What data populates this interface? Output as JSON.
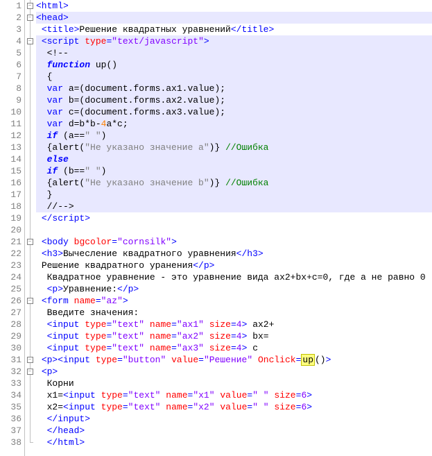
{
  "lines": [
    {
      "n": 1,
      "hl": false,
      "fold": "box",
      "parts": [
        {
          "c": "tag",
          "t": "<html>"
        }
      ]
    },
    {
      "n": 2,
      "hl": true,
      "fold": "box",
      "parts": [
        {
          "c": "tag",
          "t": "<head>"
        }
      ]
    },
    {
      "n": 3,
      "hl": false,
      "fold": "line",
      "parts": [
        {
          "c": "",
          "t": " "
        },
        {
          "c": "tag",
          "t": "<title>"
        },
        {
          "c": "txt",
          "t": "Решение квадратных уравнений"
        },
        {
          "c": "tag",
          "t": "</title>"
        }
      ]
    },
    {
      "n": 4,
      "hl": true,
      "fold": "box",
      "parts": [
        {
          "c": "",
          "t": " "
        },
        {
          "c": "tag",
          "t": "<script"
        },
        {
          "c": "",
          "t": " "
        },
        {
          "c": "attr",
          "t": "type"
        },
        {
          "c": "tag",
          "t": "="
        },
        {
          "c": "str",
          "t": "\"text/javascript\""
        },
        {
          "c": "tag",
          "t": ">"
        }
      ]
    },
    {
      "n": 5,
      "hl": true,
      "fold": "line",
      "parts": [
        {
          "c": "",
          "t": "  "
        },
        {
          "c": "txt",
          "t": "<!--"
        }
      ]
    },
    {
      "n": 6,
      "hl": true,
      "fold": "line",
      "parts": [
        {
          "c": "",
          "t": "  "
        },
        {
          "c": "kw",
          "t": "function"
        },
        {
          "c": "",
          "t": " "
        },
        {
          "c": "txt",
          "t": "up()"
        }
      ]
    },
    {
      "n": 7,
      "hl": true,
      "fold": "line",
      "parts": [
        {
          "c": "",
          "t": "  "
        },
        {
          "c": "txt",
          "t": "{"
        }
      ]
    },
    {
      "n": 8,
      "hl": true,
      "fold": "line",
      "parts": [
        {
          "c": "",
          "t": "  "
        },
        {
          "c": "kw2",
          "t": "var"
        },
        {
          "c": "",
          "t": " "
        },
        {
          "c": "txt",
          "t": "a=(document.forms.ax1.value);"
        }
      ]
    },
    {
      "n": 9,
      "hl": true,
      "fold": "line",
      "parts": [
        {
          "c": "",
          "t": "  "
        },
        {
          "c": "kw2",
          "t": "var"
        },
        {
          "c": "",
          "t": " "
        },
        {
          "c": "txt",
          "t": "b=(document.forms.ax2.value);"
        }
      ]
    },
    {
      "n": 10,
      "hl": true,
      "fold": "line",
      "parts": [
        {
          "c": "",
          "t": "  "
        },
        {
          "c": "kw2",
          "t": "var"
        },
        {
          "c": "",
          "t": " "
        },
        {
          "c": "txt",
          "t": "c=(document.forms.ax3.value);"
        }
      ]
    },
    {
      "n": 11,
      "hl": true,
      "fold": "line",
      "parts": [
        {
          "c": "",
          "t": "  "
        },
        {
          "c": "kw2",
          "t": "var"
        },
        {
          "c": "",
          "t": " "
        },
        {
          "c": "txt",
          "t": "d=b*b-"
        },
        {
          "c": "num",
          "t": "4"
        },
        {
          "c": "txt",
          "t": "a*c;"
        }
      ]
    },
    {
      "n": 12,
      "hl": true,
      "fold": "line",
      "parts": [
        {
          "c": "",
          "t": "  "
        },
        {
          "c": "kw",
          "t": "if"
        },
        {
          "c": "",
          "t": " "
        },
        {
          "c": "txt",
          "t": "(a=="
        },
        {
          "c": "gry",
          "t": "\" \""
        },
        {
          "c": "txt",
          "t": ")"
        }
      ]
    },
    {
      "n": 13,
      "hl": true,
      "fold": "line",
      "parts": [
        {
          "c": "",
          "t": "  "
        },
        {
          "c": "txt",
          "t": "{alert("
        },
        {
          "c": "gry",
          "t": "\"Не указано значение a\""
        },
        {
          "c": "txt",
          "t": ")} "
        },
        {
          "c": "cmt",
          "t": "//Ошибка"
        }
      ]
    },
    {
      "n": 14,
      "hl": true,
      "fold": "line",
      "parts": [
        {
          "c": "",
          "t": "  "
        },
        {
          "c": "kw",
          "t": "else"
        }
      ]
    },
    {
      "n": 15,
      "hl": true,
      "fold": "line",
      "parts": [
        {
          "c": "",
          "t": "  "
        },
        {
          "c": "kw",
          "t": "if"
        },
        {
          "c": "",
          "t": " "
        },
        {
          "c": "txt",
          "t": "(b=="
        },
        {
          "c": "gry",
          "t": "\" \""
        },
        {
          "c": "txt",
          "t": ")"
        }
      ]
    },
    {
      "n": 16,
      "hl": true,
      "fold": "line",
      "parts": [
        {
          "c": "",
          "t": "  "
        },
        {
          "c": "txt",
          "t": "{alert("
        },
        {
          "c": "gry",
          "t": "\"Не указано значение b\""
        },
        {
          "c": "txt",
          "t": ")} "
        },
        {
          "c": "cmt",
          "t": "//Ошибка"
        }
      ]
    },
    {
      "n": 17,
      "hl": true,
      "fold": "line",
      "parts": [
        {
          "c": "",
          "t": "  "
        },
        {
          "c": "txt",
          "t": "}"
        }
      ]
    },
    {
      "n": 18,
      "hl": true,
      "fold": "line",
      "parts": [
        {
          "c": "",
          "t": "  "
        },
        {
          "c": "txt",
          "t": "//-->"
        }
      ]
    },
    {
      "n": 19,
      "hl": false,
      "fold": "line",
      "parts": [
        {
          "c": "",
          "t": " "
        },
        {
          "c": "tag",
          "t": "</script>"
        }
      ]
    },
    {
      "n": 20,
      "hl": false,
      "fold": "line",
      "parts": []
    },
    {
      "n": 21,
      "hl": false,
      "fold": "box",
      "parts": [
        {
          "c": "",
          "t": " "
        },
        {
          "c": "tag",
          "t": "<body"
        },
        {
          "c": "",
          "t": " "
        },
        {
          "c": "attr",
          "t": "bgcolor"
        },
        {
          "c": "tag",
          "t": "="
        },
        {
          "c": "str",
          "t": "\"cornsilk\""
        },
        {
          "c": "tag",
          "t": ">"
        }
      ]
    },
    {
      "n": 22,
      "hl": false,
      "fold": "line",
      "parts": [
        {
          "c": "",
          "t": " "
        },
        {
          "c": "tag",
          "t": "<h3>"
        },
        {
          "c": "txt",
          "t": "Вычесление квадратного уравнения"
        },
        {
          "c": "tag",
          "t": "</h3>"
        }
      ]
    },
    {
      "n": 23,
      "hl": false,
      "fold": "line",
      "parts": [
        {
          "c": "",
          "t": " "
        },
        {
          "c": "txt",
          "t": "Решение квадратного уранения"
        },
        {
          "c": "tag",
          "t": "</p>"
        }
      ]
    },
    {
      "n": 24,
      "hl": false,
      "fold": "line",
      "parts": [
        {
          "c": "",
          "t": "  "
        },
        {
          "c": "txt",
          "t": "Квадратное уравнение - это уравнение вида ax2+bx+c=0, где a не равно 0"
        }
      ]
    },
    {
      "n": 25,
      "hl": false,
      "fold": "line",
      "parts": [
        {
          "c": "",
          "t": "  "
        },
        {
          "c": "tag",
          "t": "<p>"
        },
        {
          "c": "txt",
          "t": "Уравнение:"
        },
        {
          "c": "tag",
          "t": "</p>"
        }
      ]
    },
    {
      "n": 26,
      "hl": false,
      "fold": "box",
      "parts": [
        {
          "c": "",
          "t": " "
        },
        {
          "c": "tag",
          "t": "<form"
        },
        {
          "c": "",
          "t": " "
        },
        {
          "c": "attr",
          "t": "name"
        },
        {
          "c": "tag",
          "t": "="
        },
        {
          "c": "str",
          "t": "\"az\""
        },
        {
          "c": "tag",
          "t": ">"
        }
      ]
    },
    {
      "n": 27,
      "hl": false,
      "fold": "line",
      "parts": [
        {
          "c": "",
          "t": "  "
        },
        {
          "c": "txt",
          "t": "Введите значения:"
        }
      ]
    },
    {
      "n": 28,
      "hl": false,
      "fold": "line",
      "parts": [
        {
          "c": "",
          "t": "  "
        },
        {
          "c": "tag",
          "t": "<input"
        },
        {
          "c": "",
          "t": " "
        },
        {
          "c": "attr",
          "t": "type"
        },
        {
          "c": "tag",
          "t": "="
        },
        {
          "c": "str",
          "t": "\"text\""
        },
        {
          "c": "",
          "t": " "
        },
        {
          "c": "attr",
          "t": "name"
        },
        {
          "c": "tag",
          "t": "="
        },
        {
          "c": "str",
          "t": "\"ax1\""
        },
        {
          "c": "",
          "t": " "
        },
        {
          "c": "attr",
          "t": "size"
        },
        {
          "c": "tag",
          "t": "="
        },
        {
          "c": "str",
          "t": "4"
        },
        {
          "c": "tag",
          "t": ">"
        },
        {
          "c": "txt",
          "t": " ax2+"
        }
      ]
    },
    {
      "n": 29,
      "hl": false,
      "fold": "line",
      "parts": [
        {
          "c": "",
          "t": "  "
        },
        {
          "c": "tag",
          "t": "<input"
        },
        {
          "c": "",
          "t": " "
        },
        {
          "c": "attr",
          "t": "type"
        },
        {
          "c": "tag",
          "t": "="
        },
        {
          "c": "str",
          "t": "\"text\""
        },
        {
          "c": "",
          "t": " "
        },
        {
          "c": "attr",
          "t": "name"
        },
        {
          "c": "tag",
          "t": "="
        },
        {
          "c": "str",
          "t": "\"ax2\""
        },
        {
          "c": "",
          "t": " "
        },
        {
          "c": "attr",
          "t": "size"
        },
        {
          "c": "tag",
          "t": "="
        },
        {
          "c": "str",
          "t": "4"
        },
        {
          "c": "tag",
          "t": ">"
        },
        {
          "c": "txt",
          "t": " bx="
        }
      ]
    },
    {
      "n": 30,
      "hl": false,
      "fold": "line",
      "parts": [
        {
          "c": "",
          "t": "  "
        },
        {
          "c": "tag",
          "t": "<input"
        },
        {
          "c": "",
          "t": " "
        },
        {
          "c": "attr",
          "t": "type"
        },
        {
          "c": "tag",
          "t": "="
        },
        {
          "c": "str",
          "t": "\"text\""
        },
        {
          "c": "",
          "t": " "
        },
        {
          "c": "attr",
          "t": "name"
        },
        {
          "c": "tag",
          "t": "="
        },
        {
          "c": "str",
          "t": "\"ax3\""
        },
        {
          "c": "",
          "t": " "
        },
        {
          "c": "attr",
          "t": "size"
        },
        {
          "c": "tag",
          "t": "="
        },
        {
          "c": "str",
          "t": "4"
        },
        {
          "c": "tag",
          "t": ">"
        },
        {
          "c": "txt",
          "t": " c"
        }
      ]
    },
    {
      "n": 31,
      "hl": false,
      "fold": "box",
      "parts": [
        {
          "c": "",
          "t": " "
        },
        {
          "c": "tag",
          "t": "<p><input"
        },
        {
          "c": "",
          "t": " "
        },
        {
          "c": "attr",
          "t": "type"
        },
        {
          "c": "tag",
          "t": "="
        },
        {
          "c": "str",
          "t": "\"button\""
        },
        {
          "c": "",
          "t": " "
        },
        {
          "c": "attr",
          "t": "value"
        },
        {
          "c": "tag",
          "t": "="
        },
        {
          "c": "str",
          "t": "\"Решение\""
        },
        {
          "c": "",
          "t": " "
        },
        {
          "c": "attr",
          "t": "Onclick"
        },
        {
          "c": "tag",
          "t": "="
        },
        {
          "c": "fn",
          "t": "up"
        },
        {
          "c": "txt",
          "t": "()"
        },
        {
          "c": "tag",
          "t": ">"
        }
      ]
    },
    {
      "n": 32,
      "hl": false,
      "fold": "box",
      "parts": [
        {
          "c": "",
          "t": " "
        },
        {
          "c": "tag",
          "t": "<p>"
        }
      ]
    },
    {
      "n": 33,
      "hl": false,
      "fold": "line",
      "parts": [
        {
          "c": "",
          "t": "  "
        },
        {
          "c": "txt",
          "t": "Корни"
        }
      ]
    },
    {
      "n": 34,
      "hl": false,
      "fold": "line",
      "parts": [
        {
          "c": "",
          "t": "  "
        },
        {
          "c": "txt",
          "t": "x1="
        },
        {
          "c": "tag",
          "t": "<input"
        },
        {
          "c": "",
          "t": " "
        },
        {
          "c": "attr",
          "t": "type"
        },
        {
          "c": "tag",
          "t": "="
        },
        {
          "c": "str",
          "t": "\"text\""
        },
        {
          "c": "",
          "t": " "
        },
        {
          "c": "attr",
          "t": "name"
        },
        {
          "c": "tag",
          "t": "="
        },
        {
          "c": "str",
          "t": "\"x1\""
        },
        {
          "c": "",
          "t": " "
        },
        {
          "c": "attr",
          "t": "value"
        },
        {
          "c": "tag",
          "t": "="
        },
        {
          "c": "str",
          "t": "\" \""
        },
        {
          "c": "",
          "t": " "
        },
        {
          "c": "attr",
          "t": "size"
        },
        {
          "c": "tag",
          "t": "="
        },
        {
          "c": "str",
          "t": "6"
        },
        {
          "c": "tag",
          "t": ">"
        }
      ]
    },
    {
      "n": 35,
      "hl": false,
      "fold": "line",
      "parts": [
        {
          "c": "",
          "t": "  "
        },
        {
          "c": "txt",
          "t": "x2="
        },
        {
          "c": "tag",
          "t": "<input"
        },
        {
          "c": "",
          "t": " "
        },
        {
          "c": "attr",
          "t": "type"
        },
        {
          "c": "tag",
          "t": "="
        },
        {
          "c": "str",
          "t": "\"text\""
        },
        {
          "c": "",
          "t": " "
        },
        {
          "c": "attr",
          "t": "name"
        },
        {
          "c": "tag",
          "t": "="
        },
        {
          "c": "str",
          "t": "\"x2\""
        },
        {
          "c": "",
          "t": " "
        },
        {
          "c": "attr",
          "t": "value"
        },
        {
          "c": "tag",
          "t": "="
        },
        {
          "c": "str",
          "t": "\" \""
        },
        {
          "c": "",
          "t": " "
        },
        {
          "c": "attr",
          "t": "size"
        },
        {
          "c": "tag",
          "t": "="
        },
        {
          "c": "str",
          "t": "6"
        },
        {
          "c": "tag",
          "t": ">"
        }
      ]
    },
    {
      "n": 36,
      "hl": false,
      "fold": "line",
      "parts": [
        {
          "c": "",
          "t": "  "
        },
        {
          "c": "tag",
          "t": "</input>"
        }
      ]
    },
    {
      "n": 37,
      "hl": false,
      "fold": "line",
      "parts": [
        {
          "c": "",
          "t": "  "
        },
        {
          "c": "tag",
          "t": "</head>"
        }
      ]
    },
    {
      "n": 38,
      "hl": false,
      "fold": "end",
      "parts": [
        {
          "c": "",
          "t": "  "
        },
        {
          "c": "tag",
          "t": "</html>"
        }
      ]
    }
  ]
}
